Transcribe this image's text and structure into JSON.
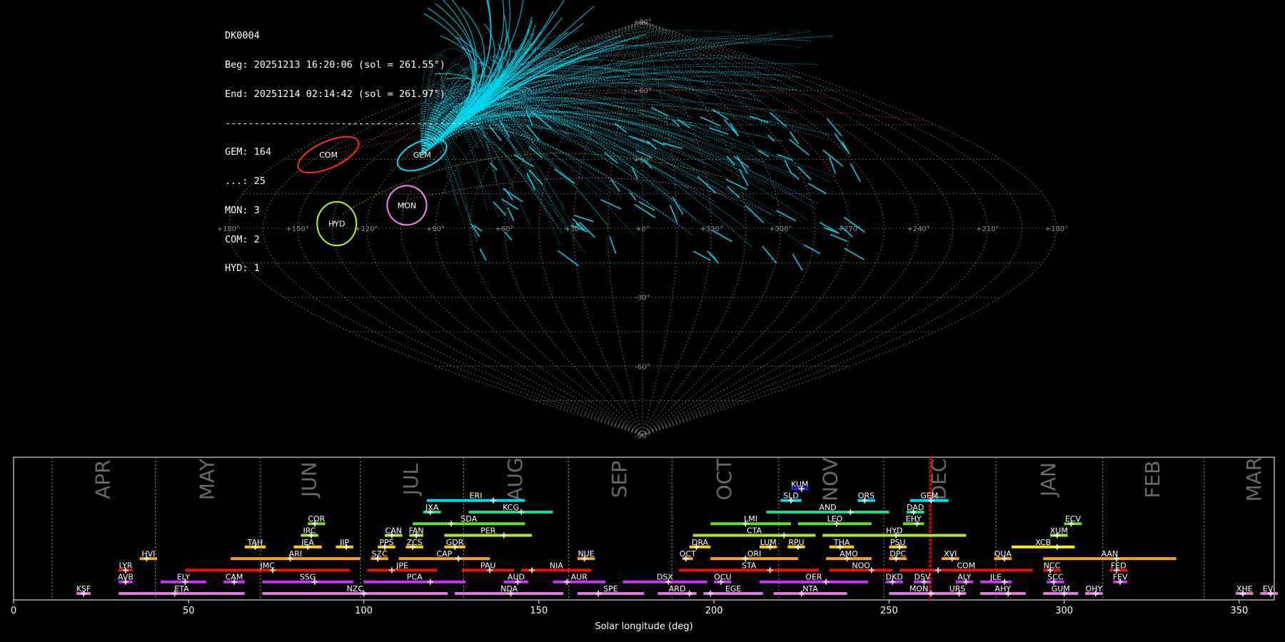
{
  "info": {
    "id": "DK0004",
    "begin": "Beg: 20251213 16:20:06 (sol = 261.55°)",
    "end": "End: 20251214 02:14:42 (sol = 261.97°)",
    "separator": "--------------------------------------------",
    "counts": [
      "GEM: 164",
      "...: 25",
      "MON: 3",
      "COM: 2",
      "HYD: 1"
    ]
  },
  "colors": {
    "background": "#000000",
    "GEM": "#00d8f0",
    "COM": "#ff2a10",
    "MON": "#ff80ff",
    "HYD": "#aaff22",
    "sporadic": "#ff3b1f",
    "grid": "#8a8a8a",
    "current_sol": "#ff0000"
  },
  "chart_data": [
    {
      "type": "scatter",
      "projection": "sinusoidal",
      "grid": true,
      "lon_ticks": [
        "+180°",
        "+150°",
        "+120°",
        "+90°",
        "+60°",
        "+30°",
        "+0°",
        "+330°",
        "+300°",
        "+270°",
        "+240°",
        "+210°",
        "+180°"
      ],
      "lat_ticks": [
        "+90°",
        "+60°",
        "+30°",
        "-30°",
        "-60°",
        "-90°"
      ],
      "radiants": [
        {
          "code": "COM",
          "lon": 161,
          "lat": 32,
          "color": "#ff2a10",
          "rx": 15,
          "ry": 6,
          "rot": -24
        },
        {
          "code": "GEM",
          "lon": 113,
          "lat": 32,
          "color": "#00d8f0",
          "rx": 12,
          "ry": 6,
          "rot": -24
        },
        {
          "code": "MON",
          "lon": 104,
          "lat": 10,
          "color": "#ff80ff",
          "rx": 9,
          "ry": 9,
          "rot": -15
        },
        {
          "code": "HYD",
          "lon": 133,
          "lat": 2,
          "color": "#aaff22",
          "rx": 9,
          "ry": 10,
          "rot": 0
        }
      ]
    },
    {
      "type": "bar",
      "xlabel": "Solar longitude (deg)",
      "xlim": [
        0,
        360
      ],
      "x_ticks": [
        0,
        50,
        100,
        150,
        200,
        250,
        300,
        350
      ],
      "current_sol": [
        261.55,
        261.97
      ],
      "months": [
        {
          "name": "APR",
          "start": 11
        },
        {
          "name": "MAY",
          "start": 40.5
        },
        {
          "name": "JUN",
          "start": 70.5
        },
        {
          "name": "JUL",
          "start": 99
        },
        {
          "name": "AUG",
          "start": 128.5
        },
        {
          "name": "SEP",
          "start": 158.5
        },
        {
          "name": "OCT",
          "start": 188
        },
        {
          "name": "NOV",
          "start": 218.5
        },
        {
          "name": "DEC",
          "start": 248.5
        },
        {
          "name": "JAN",
          "start": 280.5
        },
        {
          "name": "FEB",
          "start": 311
        },
        {
          "name": "MAR",
          "start": 340
        }
      ],
      "showers": [
        {
          "code": "KSF",
          "start": 18,
          "end": 22,
          "peak": 20,
          "row": 0,
          "color": "#dd77dd"
        },
        {
          "code": "ETA",
          "start": 30,
          "end": 66,
          "peak": 46,
          "row": 0,
          "color": "#dd77dd"
        },
        {
          "code": "NZC",
          "start": 71,
          "end": 124,
          "peak": 100,
          "row": 0,
          "color": "#dd77dd"
        },
        {
          "code": "NDA",
          "start": 126,
          "end": 157,
          "peak": 142,
          "row": 0,
          "color": "#dd77dd"
        },
        {
          "code": "SPE",
          "start": 161,
          "end": 180,
          "peak": 167,
          "row": 0,
          "color": "#dd77dd"
        },
        {
          "code": "ARD",
          "start": 184,
          "end": 195,
          "peak": 193,
          "row": 0,
          "color": "#dd77dd"
        },
        {
          "code": "EGE",
          "start": 197,
          "end": 214,
          "peak": 199,
          "row": 0,
          "color": "#dd77dd"
        },
        {
          "code": "NTA",
          "start": 217,
          "end": 238,
          "peak": 225,
          "row": 0,
          "color": "#dd77dd"
        },
        {
          "code": "MON",
          "start": 250,
          "end": 267,
          "peak": 262,
          "row": 0,
          "color": "#dd77dd"
        },
        {
          "code": "URS",
          "start": 267,
          "end": 272,
          "peak": 270,
          "row": 0,
          "color": "#dd77dd"
        },
        {
          "code": "AHY",
          "start": 276,
          "end": 289,
          "peak": 284,
          "row": 0,
          "color": "#dd77dd"
        },
        {
          "code": "GUM",
          "start": 294,
          "end": 304,
          "peak": 300,
          "row": 0,
          "color": "#dd77dd"
        },
        {
          "code": "OHY",
          "start": 306,
          "end": 311,
          "peak": 309,
          "row": 0,
          "color": "#dd77dd"
        },
        {
          "code": "XHE",
          "start": 349,
          "end": 354,
          "peak": 351,
          "row": 0,
          "color": "#dd77dd"
        },
        {
          "code": "EVI",
          "start": 356,
          "end": 361,
          "peak": 359,
          "row": 0,
          "color": "#dd77dd"
        },
        {
          "code": "AVB",
          "start": 30,
          "end": 34,
          "peak": 32,
          "row": 1,
          "color": "#cc33ff"
        },
        {
          "code": "ELY",
          "start": 42,
          "end": 55,
          "peak": 49,
          "row": 1,
          "color": "#cc33ff"
        },
        {
          "code": "CAM",
          "start": 60,
          "end": 66,
          "peak": 63,
          "row": 1,
          "color": "#cc33ff"
        },
        {
          "code": "SSG",
          "start": 71,
          "end": 97,
          "peak": 86,
          "row": 1,
          "color": "#cc33ff"
        },
        {
          "code": "PCA",
          "start": 100,
          "end": 129,
          "peak": 119,
          "row": 1,
          "color": "#cc33ff"
        },
        {
          "code": "AUD",
          "start": 140,
          "end": 147,
          "peak": 144,
          "row": 1,
          "color": "#cc33ff"
        },
        {
          "code": "AUR",
          "start": 154,
          "end": 169,
          "peak": 158,
          "row": 1,
          "color": "#cc33ff"
        },
        {
          "code": "DSX",
          "start": 174,
          "end": 198,
          "peak": 187,
          "row": 1,
          "color": "#cc33ff"
        },
        {
          "code": "OCU",
          "start": 200,
          "end": 205,
          "peak": 202,
          "row": 1,
          "color": "#cc33ff"
        },
        {
          "code": "OER",
          "start": 213,
          "end": 244,
          "peak": 232,
          "row": 1,
          "color": "#cc33ff"
        },
        {
          "code": "DKD",
          "start": 249,
          "end": 254,
          "peak": 251,
          "row": 1,
          "color": "#cc33ff"
        },
        {
          "code": "DSV",
          "start": 257,
          "end": 262,
          "peak": 260,
          "row": 1,
          "color": "#cc33ff"
        },
        {
          "code": "ALY",
          "start": 269,
          "end": 274,
          "peak": 272,
          "row": 1,
          "color": "#cc33ff"
        },
        {
          "code": "JLE",
          "start": 276,
          "end": 285,
          "peak": 283,
          "row": 1,
          "color": "#cc33ff"
        },
        {
          "code": "SCC",
          "start": 295,
          "end": 300,
          "peak": 297,
          "row": 1,
          "color": "#cc33ff"
        },
        {
          "code": "FEV",
          "start": 314,
          "end": 318,
          "peak": 316,
          "row": 1,
          "color": "#cc33ff"
        },
        {
          "code": "LYR",
          "start": 30,
          "end": 34,
          "peak": 32,
          "row": 2,
          "color": "#ee1111"
        },
        {
          "code": "JMC",
          "start": 49,
          "end": 96,
          "peak": 74,
          "row": 2,
          "color": "#ee1111"
        },
        {
          "code": "JPE",
          "start": 101,
          "end": 121,
          "peak": 108,
          "row": 2,
          "color": "#ee1111"
        },
        {
          "code": "PAU",
          "start": 128,
          "end": 143,
          "peak": 136,
          "row": 2,
          "color": "#ee1111"
        },
        {
          "code": "NIA",
          "start": 145,
          "end": 165,
          "peak": 148,
          "row": 2,
          "color": "#ee1111"
        },
        {
          "code": "STA",
          "start": 190,
          "end": 230,
          "peak": 216,
          "row": 2,
          "color": "#ee1111"
        },
        {
          "code": "NOO",
          "start": 233,
          "end": 251,
          "peak": 245,
          "row": 2,
          "color": "#ee1111"
        },
        {
          "code": "COM",
          "start": 253,
          "end": 291,
          "peak": 264,
          "row": 2,
          "color": "#ee1111"
        },
        {
          "code": "NCC",
          "start": 294,
          "end": 299,
          "peak": 296,
          "row": 2,
          "color": "#ee1111"
        },
        {
          "code": "FED",
          "start": 313,
          "end": 318,
          "peak": 315,
          "row": 2,
          "color": "#ee1111"
        },
        {
          "code": "HVI",
          "start": 36,
          "end": 41,
          "peak": 38,
          "row": 3,
          "color": "#ffa500"
        },
        {
          "code": "ARI",
          "start": 62,
          "end": 99,
          "peak": 79,
          "row": 3,
          "color": "#ffa500"
        },
        {
          "code": "SZC",
          "start": 102,
          "end": 107,
          "peak": 104,
          "row": 3,
          "color": "#ffa500"
        },
        {
          "code": "CAP",
          "start": 110,
          "end": 136,
          "peak": 127,
          "row": 3,
          "color": "#ffa500"
        },
        {
          "code": "NUE",
          "start": 161,
          "end": 166,
          "peak": 163,
          "row": 3,
          "color": "#ffa500"
        },
        {
          "code": "OCT",
          "start": 191,
          "end": 194,
          "peak": 192,
          "row": 3,
          "color": "#ffa500"
        },
        {
          "code": "ORI",
          "start": 199,
          "end": 224,
          "peak": 209,
          "row": 3,
          "color": "#ffa500"
        },
        {
          "code": "AMO",
          "start": 232,
          "end": 245,
          "peak": 238,
          "row": 3,
          "color": "#ffa500"
        },
        {
          "code": "DPC",
          "start": 250,
          "end": 255,
          "peak": 252,
          "row": 3,
          "color": "#ffa500"
        },
        {
          "code": "XVI",
          "start": 265,
          "end": 270,
          "peak": 268,
          "row": 3,
          "color": "#ffa500"
        },
        {
          "code": "QUA",
          "start": 280,
          "end": 285,
          "peak": 283,
          "row": 3,
          "color": "#ffa500"
        },
        {
          "code": "AAN",
          "start": 294,
          "end": 332,
          "peak": 315,
          "row": 3,
          "color": "#ffa500"
        },
        {
          "code": "TAH",
          "start": 66,
          "end": 72,
          "peak": 69,
          "row": 4,
          "color": "#ffd000"
        },
        {
          "code": "JEA",
          "start": 80,
          "end": 88,
          "peak": 84,
          "row": 4,
          "color": "#ffd000"
        },
        {
          "code": "JIP",
          "start": 92,
          "end": 97,
          "peak": 95,
          "row": 4,
          "color": "#ffd000"
        },
        {
          "code": "PPS",
          "start": 104,
          "end": 109,
          "peak": 106,
          "row": 4,
          "color": "#ffd000"
        },
        {
          "code": "ZCS",
          "start": 112,
          "end": 117,
          "peak": 114,
          "row": 4,
          "color": "#ffd000"
        },
        {
          "code": "GDR",
          "start": 123,
          "end": 129,
          "peak": 126,
          "row": 4,
          "color": "#ffd000"
        },
        {
          "code": "DRA",
          "start": 193,
          "end": 199,
          "peak": 195,
          "row": 4,
          "color": "#ffd000"
        },
        {
          "code": "LUM",
          "start": 213,
          "end": 218,
          "peak": 216,
          "row": 4,
          "color": "#ffd000"
        },
        {
          "code": "RPU",
          "start": 221,
          "end": 226,
          "peak": 224,
          "row": 4,
          "color": "#ffd000"
        },
        {
          "code": "THA",
          "start": 233,
          "end": 240,
          "peak": 236,
          "row": 4,
          "color": "#ffd000"
        },
        {
          "code": "PSU",
          "start": 250,
          "end": 255,
          "peak": 253,
          "row": 4,
          "color": "#ffd000"
        },
        {
          "code": "XCB",
          "start": 285,
          "end": 303,
          "peak": 298,
          "row": 4,
          "color": "#ffee00"
        },
        {
          "code": "IRC",
          "start": 82,
          "end": 87,
          "peak": 85,
          "row": 5,
          "color": "#aaee22"
        },
        {
          "code": "CAN",
          "start": 106,
          "end": 111,
          "peak": 108,
          "row": 5,
          "color": "#aaee22"
        },
        {
          "code": "FAN",
          "start": 113,
          "end": 117,
          "peak": 115,
          "row": 5,
          "color": "#aaee22"
        },
        {
          "code": "PER",
          "start": 123,
          "end": 148,
          "peak": 140,
          "row": 5,
          "color": "#aaee22"
        },
        {
          "code": "CTA",
          "start": 194,
          "end": 229,
          "peak": 220,
          "row": 5,
          "color": "#aaee22"
        },
        {
          "code": "HYD",
          "start": 231,
          "end": 272,
          "peak": 252,
          "row": 5,
          "color": "#aaee22"
        },
        {
          "code": "XUM",
          "start": 296,
          "end": 301,
          "peak": 298,
          "row": 5,
          "color": "#aaee22"
        },
        {
          "code": "COR",
          "start": 84,
          "end": 89,
          "peak": 86,
          "row": 6,
          "color": "#66dd22"
        },
        {
          "code": "SDA",
          "start": 114,
          "end": 146,
          "peak": 125,
          "row": 6,
          "color": "#66dd22"
        },
        {
          "code": "LMI",
          "start": 199,
          "end": 222,
          "peak": 209,
          "row": 6,
          "color": "#66dd22"
        },
        {
          "code": "LEO",
          "start": 224,
          "end": 245,
          "peak": 235,
          "row": 6,
          "color": "#66dd22"
        },
        {
          "code": "EHY",
          "start": 254,
          "end": 260,
          "peak": 258,
          "row": 6,
          "color": "#66dd22"
        },
        {
          "code": "ECV",
          "start": 300,
          "end": 305,
          "peak": 302,
          "row": 6,
          "color": "#66dd22"
        },
        {
          "code": "JXA",
          "start": 117,
          "end": 122,
          "peak": 119,
          "row": 7,
          "color": "#22dd88"
        },
        {
          "code": "KCG",
          "start": 130,
          "end": 154,
          "peak": 145,
          "row": 7,
          "color": "#22dd88"
        },
        {
          "code": "AND",
          "start": 215,
          "end": 250,
          "peak": 239,
          "row": 7,
          "color": "#22dd88"
        },
        {
          "code": "DAD",
          "start": 255,
          "end": 260,
          "peak": 257,
          "row": 7,
          "color": "#22dd88"
        },
        {
          "code": "ERI",
          "start": 118,
          "end": 146,
          "peak": 137,
          "row": 8,
          "color": "#00ddee"
        },
        {
          "code": "SLD",
          "start": 219,
          "end": 225,
          "peak": 222,
          "row": 8,
          "color": "#00ddee"
        },
        {
          "code": "ORS",
          "start": 241,
          "end": 246,
          "peak": 243,
          "row": 8,
          "color": "#00ddee"
        },
        {
          "code": "GEM",
          "start": 256,
          "end": 267,
          "peak": 262,
          "row": 8,
          "color": "#00ddee"
        },
        {
          "code": "KUM",
          "start": 222,
          "end": 227,
          "peak": 225,
          "row": 9,
          "color": "#2222ff"
        }
      ]
    }
  ]
}
